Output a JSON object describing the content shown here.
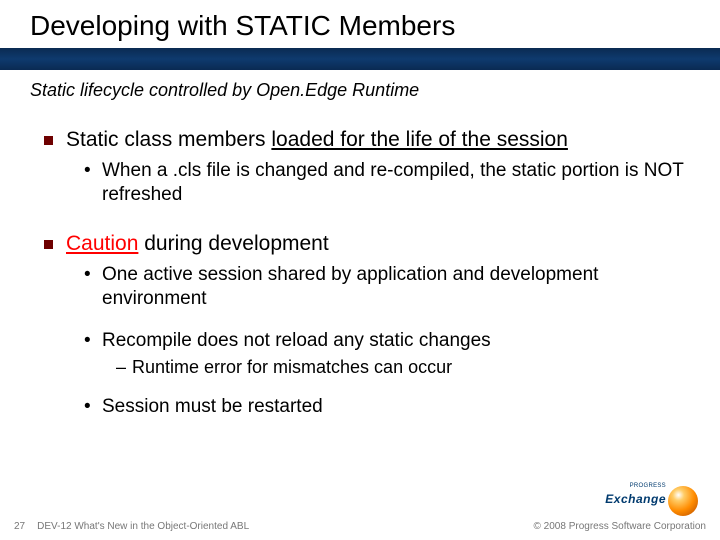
{
  "title": "Developing with STATIC Members",
  "subtitle": "Static lifecycle controlled by Open.Edge Runtime",
  "bullets": {
    "b1_pre": "Static class members ",
    "b1_u": "loaded for the life of the session",
    "b1_1": "When a .cls file is changed and re-compiled, the static portion is NOT refreshed",
    "b2_caution": "Caution",
    "b2_rest": " during development",
    "b2_1": "One active session shared by application and development environment",
    "b2_2": "Recompile does not reload any static changes",
    "b2_2_1": "Runtime error for mismatches can occur",
    "b2_3": "Session must be restarted"
  },
  "footer": {
    "page": "27",
    "docname": "DEV-12 What's New in the Object-Oriented ABL",
    "copyright": "© 2008 Progress Software Corporation"
  },
  "logo": {
    "small": "PROGRESS",
    "text": "Exchange"
  }
}
